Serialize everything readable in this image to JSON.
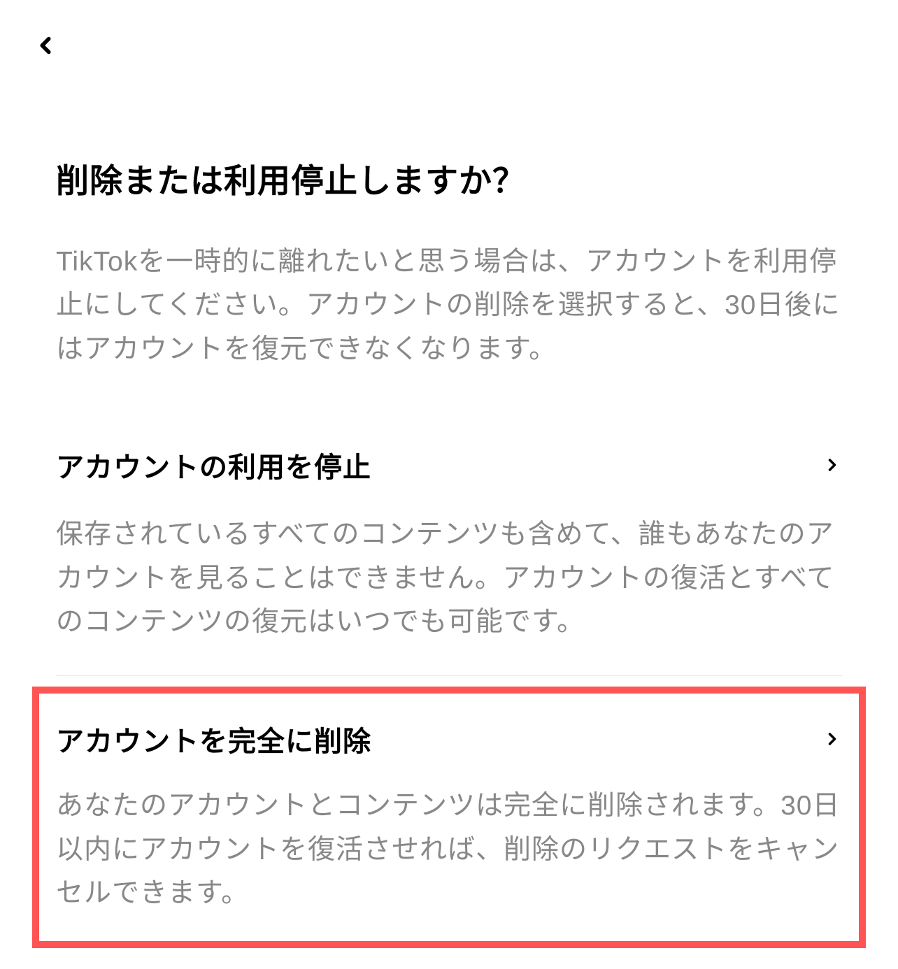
{
  "header": {
    "back_icon_name": "back-icon"
  },
  "page": {
    "title": "削除または利用停止しますか？",
    "description": "TikTokを一時的に離れたいと思う場合は、アカウントを利用停止にしてください。アカウントの削除を選択すると、30日後にはアカウントを復元できなくなります。"
  },
  "options": [
    {
      "title": "アカウントの利用を停止",
      "description": "保存されているすべてのコンテンツも含めて、誰もあなたのアカウントを見ることはできません。アカウントの復活とすべてのコンテンツの復元はいつでも可能です。",
      "highlighted": false
    },
    {
      "title": "アカウントを完全に削除",
      "description": "あなたのアカウントとコンテンツは完全に削除されます。30日以内にアカウントを復活させれば、削除のリクエストをキャンセルできます。",
      "highlighted": true
    }
  ],
  "colors": {
    "highlight_border": "#fe5454",
    "text_primary": "#000000",
    "text_secondary": "#888888"
  }
}
